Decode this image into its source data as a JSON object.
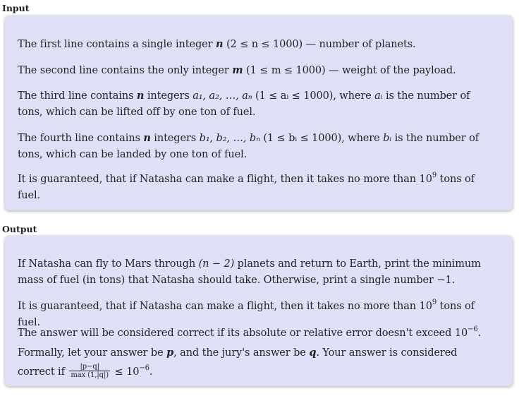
{
  "input": {
    "heading": "Input",
    "p1": {
      "before": "The first line contains a single integer ",
      "var": "n",
      "range": " (2 ≤ n ≤ 1000)",
      "after": " — number of planets."
    },
    "p2": {
      "before": "The second line contains the only integer ",
      "var": "m",
      "range": " (1 ≤ m ≤ 1000)",
      "after": " — weight of the payload."
    },
    "p3": {
      "before": "The third line contains ",
      "var": "n",
      "mid": " integers ",
      "seq": "a₁, a₂, …, aₙ",
      "range": " (1 ≤ aᵢ ≤ 1000)",
      "where": ", where ",
      "ai": "aᵢ",
      "after": " is the number of tons, which can be lifted off by one ton of fuel."
    },
    "p4": {
      "before": "The fourth line contains ",
      "var": "n",
      "mid": " integers ",
      "seq": "b₁, b₂, …, bₙ",
      "range": " (1 ≤ bᵢ ≤ 1000)",
      "where": ", where ",
      "bi": "bᵢ",
      "after": " is the number of tons, which can be landed by one ton of fuel."
    },
    "p5": {
      "before": "It is guaranteed, that if Natasha can make a flight, then it takes no more than ",
      "base": "10",
      "exp": "9",
      "after": " tons of fuel."
    }
  },
  "output": {
    "heading": "Output",
    "p1": {
      "before": "If Natasha can fly to Mars through ",
      "expr": "(n − 2)",
      "mid": " planets and return to Earth, print the minimum mass of fuel (in tons) that Natasha should take. Otherwise, print a single number ",
      "neg": "−1",
      "after": "."
    },
    "p2": {
      "before": "It is guaranteed, that if Natasha can make a flight, then it takes no more than ",
      "base": "10",
      "exp": "9",
      "after": " tons of fuel."
    },
    "p3": {
      "before": "The answer will be considered correct if its absolute or relative error doesn't exceed ",
      "base": "10",
      "exp": "−6",
      "mid1": ". Formally, let your answer be ",
      "p": "p",
      "mid2": ", and the jury's answer be ",
      "q": "q",
      "mid3": ". Your answer is considered correct if ",
      "frac_num": "|p−q|",
      "frac_den": "max (1,|q|)",
      "leq": " ≤ ",
      "base2": "10",
      "exp2": "−6",
      "after": "."
    }
  }
}
